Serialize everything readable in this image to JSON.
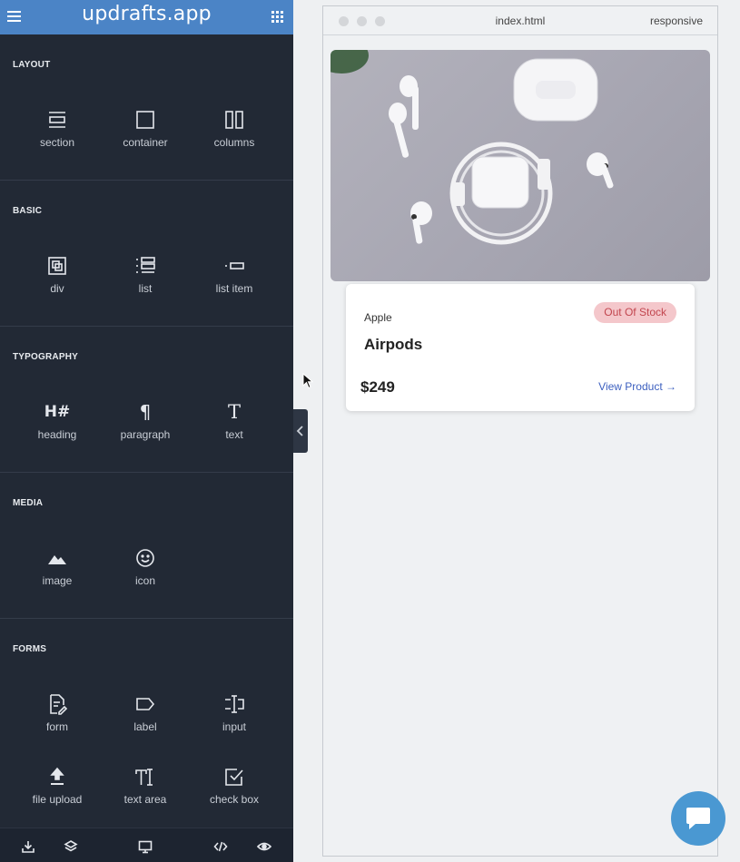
{
  "app": {
    "brand": "updrafts.app"
  },
  "sidebar": {
    "sections": [
      {
        "title": "LAYOUT",
        "tools": [
          {
            "label": "section",
            "icon": "section-icon"
          },
          {
            "label": "container",
            "icon": "container-icon"
          },
          {
            "label": "columns",
            "icon": "columns-icon"
          }
        ]
      },
      {
        "title": "BASIC",
        "tools": [
          {
            "label": "div",
            "icon": "div-icon"
          },
          {
            "label": "list",
            "icon": "list-icon"
          },
          {
            "label": "list item",
            "icon": "list-item-icon"
          }
        ]
      },
      {
        "title": "TYPOGRAPHY",
        "tools": [
          {
            "label": "heading",
            "icon": "heading-icon"
          },
          {
            "label": "paragraph",
            "icon": "paragraph-icon"
          },
          {
            "label": "text",
            "icon": "text-icon"
          }
        ]
      },
      {
        "title": "MEDIA",
        "tools": [
          {
            "label": "image",
            "icon": "image-icon"
          },
          {
            "label": "icon",
            "icon": "smiley-icon"
          }
        ]
      },
      {
        "title": "FORMS",
        "tools": [
          {
            "label": "form",
            "icon": "form-icon"
          },
          {
            "label": "label",
            "icon": "label-icon"
          },
          {
            "label": "input",
            "icon": "input-icon"
          },
          {
            "label": "file upload",
            "icon": "upload-icon"
          },
          {
            "label": "text area",
            "icon": "textarea-icon"
          },
          {
            "label": "check box",
            "icon": "checkbox-icon"
          }
        ]
      }
    ],
    "heading_glyph": "H#",
    "paragraph_glyph": "¶",
    "text_glyph": "T"
  },
  "bottom_bar": [
    "download-icon",
    "layers-icon",
    "desktop-icon",
    "code-icon",
    "eye-icon"
  ],
  "preview": {
    "file_name": "index.html",
    "mode": "responsive"
  },
  "product_card": {
    "brand": "Apple",
    "badge": "Out Of Stock",
    "title": "Airpods",
    "price": "$249",
    "link": "View Product →"
  },
  "colors": {
    "sidebar_bg": "#222935",
    "topbar": "#4b84c6",
    "badge_bg": "#f4c7cb",
    "badge_text": "#c2464f",
    "link": "#3c5fbf",
    "chat_button": "#4a98d2"
  }
}
